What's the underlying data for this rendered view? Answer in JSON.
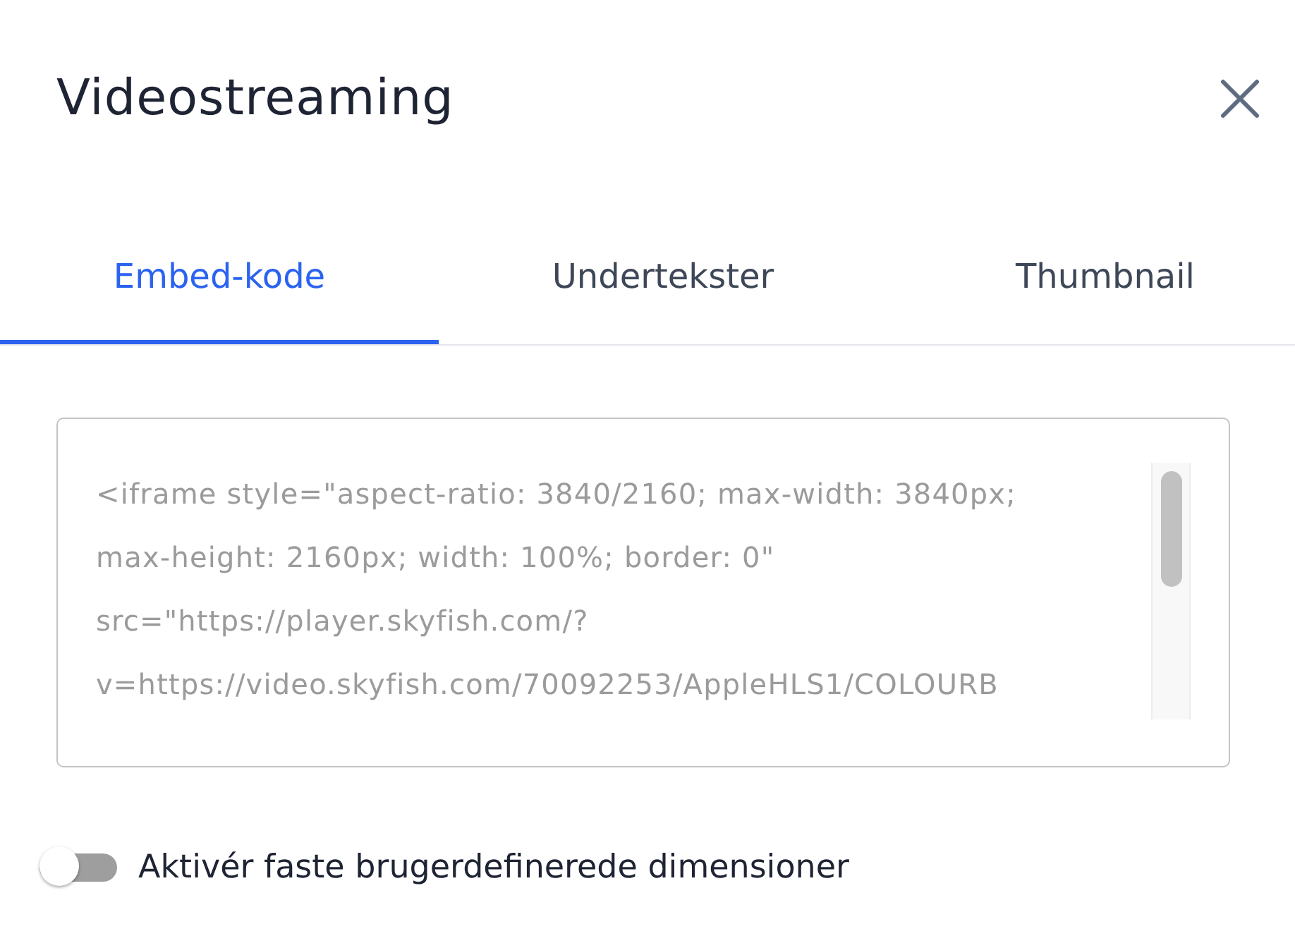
{
  "dialog": {
    "title": "Videostreaming"
  },
  "tabs": [
    {
      "label": "Embed-kode",
      "selected": true
    },
    {
      "label": "Undertekster",
      "selected": false
    },
    {
      "label": "Thumbnail",
      "selected": false
    }
  ],
  "embed_code": {
    "lines": [
      "<iframe style=\"aspect-ratio: 3840/2160; max-width: 3840px;",
      "max-height: 2160px; width: 100%; border: 0\"",
      "src=\"https://player.skyfish.com/?",
      "v=https://video.skyfish.com/70092253/AppleHLS1/COLOURB"
    ]
  },
  "toggle": {
    "label": "Aktivér faste brugerdefinerede dimensioner",
    "on": false
  }
}
